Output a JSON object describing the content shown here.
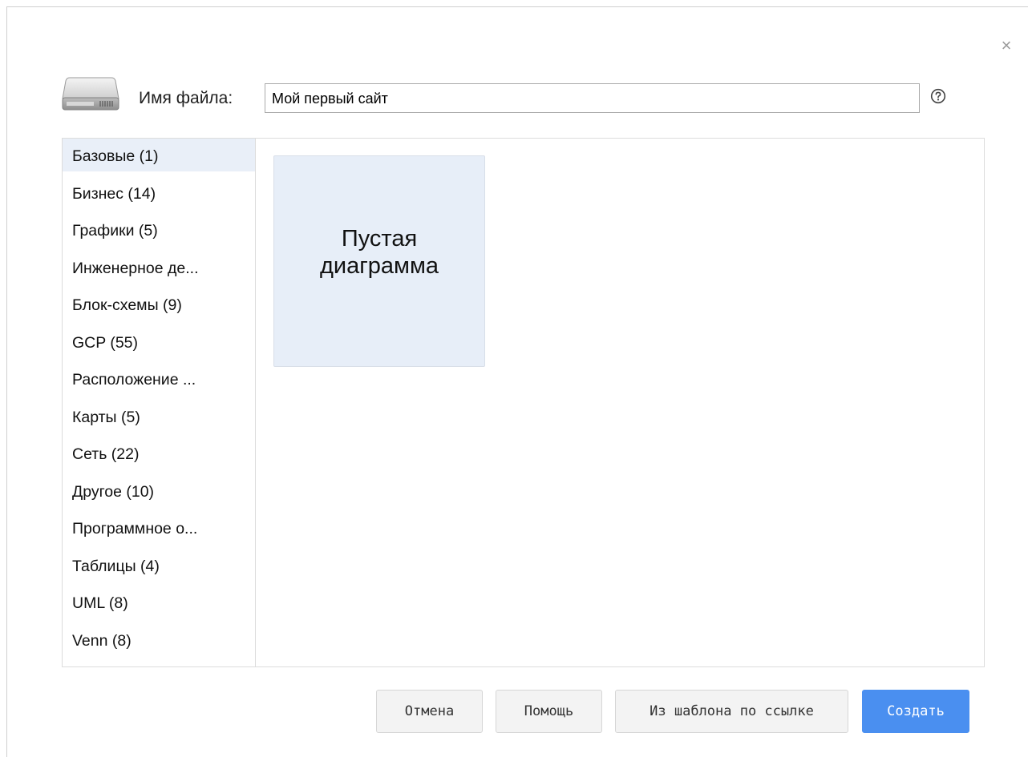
{
  "dialog": {
    "close_symbol": "×"
  },
  "filename": {
    "label": "Имя файла:",
    "value": "Мой первый сайт",
    "icon": "hard-drive-icon",
    "help_icon": "question-circle-icon"
  },
  "categories": [
    {
      "label": "Базовые (1)",
      "selected": true
    },
    {
      "label": "Бизнес (14)",
      "selected": false
    },
    {
      "label": "Графики (5)",
      "selected": false
    },
    {
      "label": "Инженерное де...",
      "selected": false
    },
    {
      "label": "Блок-схемы (9)",
      "selected": false
    },
    {
      "label": "GCP (55)",
      "selected": false
    },
    {
      "label": "Расположение ...",
      "selected": false
    },
    {
      "label": "Карты (5)",
      "selected": false
    },
    {
      "label": "Сеть (22)",
      "selected": false
    },
    {
      "label": "Другое (10)",
      "selected": false
    },
    {
      "label": "Программное о...",
      "selected": false
    },
    {
      "label": "Таблицы (4)",
      "selected": false
    },
    {
      "label": "UML (8)",
      "selected": false
    },
    {
      "label": "Venn (8)",
      "selected": false
    }
  ],
  "templates": [
    {
      "label": "Пустая диаграмма"
    }
  ],
  "buttons": {
    "cancel": "Отмена",
    "help": "Помощь",
    "from_url": "Из шаблона по ссылке",
    "create": "Создать"
  },
  "colors": {
    "primary": "#4a8ff0",
    "selected_bg": "#e9eff8",
    "tile_bg": "#e7eef8"
  }
}
